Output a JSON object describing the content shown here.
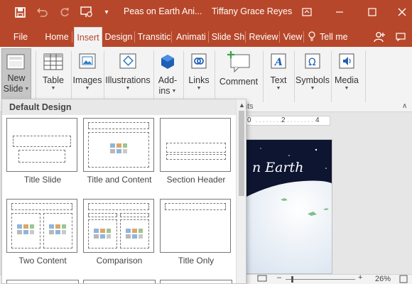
{
  "app": {
    "accent": "#b7472a",
    "doc_title": "Peas on Earth Ani...",
    "user_name": "Tiffany Grace Reyes"
  },
  "quick_access": [
    "save-icon",
    "undo-icon",
    "redo-icon",
    "start-from-beginning-icon",
    "customize-qat-icon"
  ],
  "window_controls": [
    "ribbon-display-options-icon",
    "minimize-icon",
    "maximize-icon",
    "close-icon"
  ],
  "tabs": {
    "file": "File",
    "home": "Home",
    "insert": "Insert",
    "design": "Design",
    "transitions": "Transitic",
    "animations": "Animati",
    "slideshow": "Slide Sh",
    "review": "Review",
    "view": "View",
    "tellme": "Tell me",
    "active": "Insert"
  },
  "ribbon": {
    "new_slide_line1": "New",
    "new_slide_line2": "Slide",
    "table": "Table",
    "images": "Images",
    "illustrations": "Illustrations",
    "addins_line1": "Add-",
    "addins_line2": "ins",
    "links": "Links",
    "comment": "Comment",
    "text": "Text",
    "symbols": "Symbols",
    "media": "Media",
    "group_comments_fragment": "nts"
  },
  "layouts": {
    "header": "Default Design",
    "items": [
      {
        "name": "Title Slide"
      },
      {
        "name": "Title and Content"
      },
      {
        "name": "Section Header"
      },
      {
        "name": "Two Content"
      },
      {
        "name": "Comparison"
      },
      {
        "name": "Title Only"
      }
    ]
  },
  "ruler": {
    "marks": [
      "0",
      "2",
      "4"
    ]
  },
  "slide": {
    "title_fragment": "n Earth"
  },
  "status": {
    "zoom": "26%"
  }
}
